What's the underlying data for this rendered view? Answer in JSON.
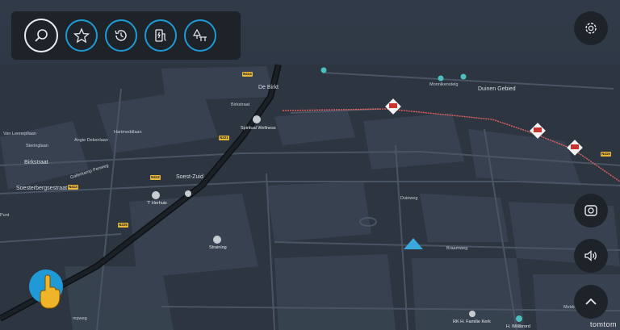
{
  "toolbar": {
    "buttons": [
      {
        "icon": "search-icon"
      },
      {
        "icon": "star-icon"
      },
      {
        "icon": "history-icon"
      },
      {
        "icon": "ev-charging-icon"
      },
      {
        "icon": "parking-icon"
      }
    ]
  },
  "controls": {
    "settings_icon": "gear-icon",
    "camera_icon": "camera-icon",
    "sound_icon": "speaker-icon",
    "expand_icon": "chevron-up-icon"
  },
  "map_labels": {
    "de_birkt": "De Birkt",
    "duinen_gebied": "Duinen Gebied",
    "birkstraat": "Birkstraat",
    "soesterbergsestraat": "Soesterbergsestraat",
    "soest_zuid": "Soest-Zuid",
    "spiritual_wellness": "Spiritual Wellness",
    "t_herhuis": "'T Herhuis",
    "straining": "Straining",
    "rk_kerk": "RK H. Familie Kerk",
    "h_willibrord": "H. Willibrord",
    "birkstraat_small": "Birkstraat",
    "anger_dekenlaan": "Angie Dekenlaan",
    "gallerkamp": "Gallerkamp Penweg",
    "van_lenneplaan": "Van Lennepllaan",
    "sterinqlaan": "Steringlaan",
    "hartenlaan": "Hartmeddlaan",
    "duinweg": "Duinweg",
    "braamweg": "Braamweg",
    "punt": "Punt",
    "mpweg": "mpweg",
    "meldo": "Meldo",
    "monnikensteeg": "Monnikenstelg",
    "shield_n221": "N221",
    "shield_n415": "N415",
    "shield_n413": "N413",
    "shield_n412": "N412",
    "shield_n225": "N225",
    "shield_n414": "N414"
  },
  "attribution": "tomtom",
  "colors": {
    "accent": "#1f9ad6",
    "route": "#e0605f",
    "background": "#2b3340",
    "panel": "#1d2329"
  }
}
